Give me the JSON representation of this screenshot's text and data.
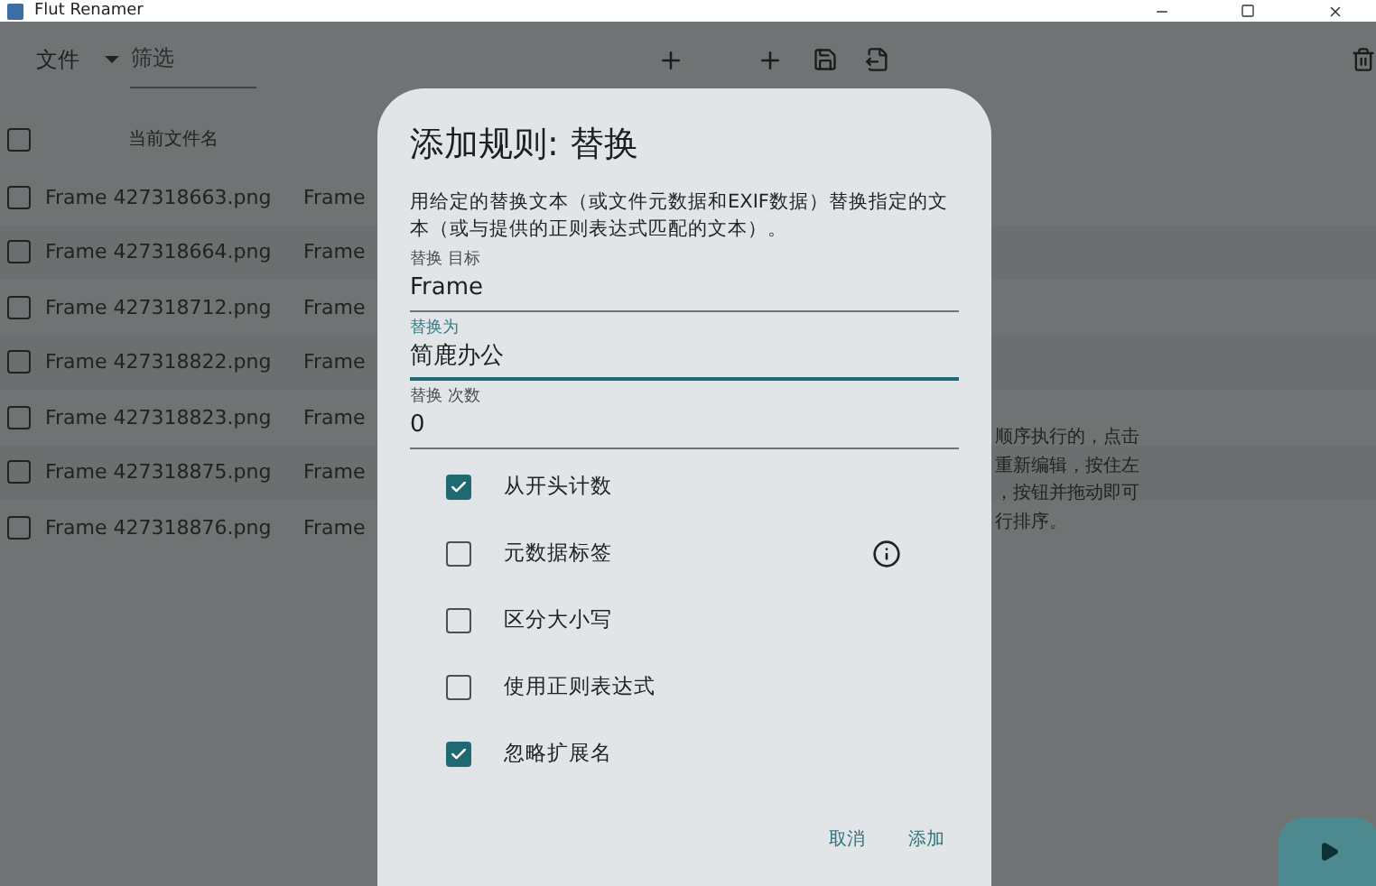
{
  "window": {
    "title": "Flut Renamer"
  },
  "toolbar": {
    "menu": "文件",
    "filter": {
      "placeholder": "筛选"
    }
  },
  "table": {
    "header_checked": false,
    "columns": [
      {
        "label": "当前文件名"
      }
    ],
    "rows": [
      {
        "name": "Frame 427318663.png",
        "column_2": "Frame",
        "checked": false
      },
      {
        "name": "Frame 427318664.png",
        "column_2": "Frame",
        "checked": false
      },
      {
        "name": "Frame 427318712.png",
        "column_2": "Frame",
        "checked": false
      },
      {
        "name": "Frame 427318822.png",
        "column_2": "Frame",
        "checked": false
      },
      {
        "name": "Frame 427318823.png",
        "column_2": "Frame",
        "checked": false
      },
      {
        "name": "Frame 427318875.png",
        "column_2": "Frame",
        "checked": false
      },
      {
        "name": "Frame 427318876.png",
        "column_2": "Frame",
        "checked": false
      }
    ]
  },
  "help_text": [
    "顺序执行的，点击",
    "重新编辑，按住左",
    "，按钮并拖动即可",
    "行排序。"
  ],
  "dialog": {
    "title": "添加规则: 替换",
    "description": "用给定的替换文本（或文件元数据和EXIF数据）替换指定的文本（或与提供的正则表达式匹配的文本）。",
    "fields": [
      {
        "label": "替换 目标",
        "value": "Frame",
        "focused": false
      },
      {
        "label": "替换为",
        "value": "简鹿办公",
        "focused": true
      },
      {
        "label": "替换 次数",
        "value": "0",
        "focused": false
      }
    ],
    "options": [
      {
        "label": "从开头计数",
        "checked": true,
        "info": false
      },
      {
        "label": "元数据标签",
        "checked": false,
        "info": true
      },
      {
        "label": "区分大小写",
        "checked": false,
        "info": false
      },
      {
        "label": "使用正则表达式",
        "checked": false,
        "info": false
      },
      {
        "label": "忽略扩展名",
        "checked": true,
        "info": false
      }
    ],
    "buttons": [
      {
        "label": "取消"
      },
      {
        "label": "添加"
      }
    ]
  }
}
